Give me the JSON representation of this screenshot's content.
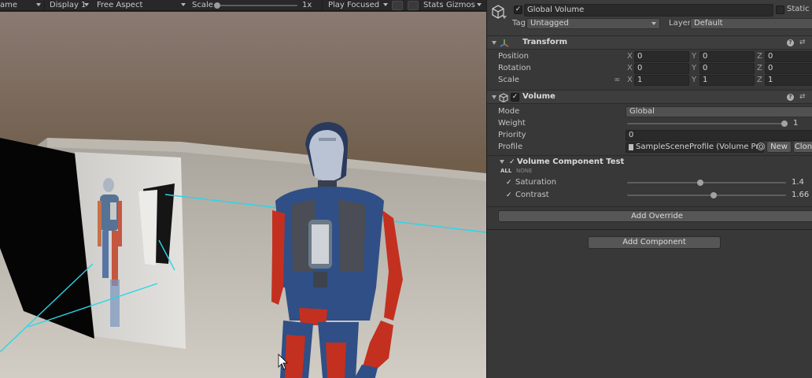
{
  "game_toolbar": {
    "tab_label": "ame",
    "display": "Display 1",
    "aspect": "Free Aspect",
    "scale_label": "Scale",
    "scale_value": "1x",
    "play_mode": "Play Focused",
    "stats": "Stats",
    "gizmos": "Gizmos"
  },
  "inspector": {
    "object_name": "Global Volume",
    "static_label": "Static",
    "tag_label": "Tag",
    "tag_value": "Untagged",
    "layer_label": "Layer",
    "layer_value": "Default",
    "transform": {
      "title": "Transform",
      "position_label": "Position",
      "rotation_label": "Rotation",
      "scale_label": "Scale",
      "axis_x": "X",
      "axis_y": "Y",
      "axis_z": "Z",
      "position": [
        "0",
        "0",
        "0"
      ],
      "rotation": [
        "0",
        "0",
        "0"
      ],
      "scale": [
        "1",
        "1",
        "1"
      ]
    },
    "volume": {
      "title": "Volume",
      "mode_label": "Mode",
      "mode_value": "Global",
      "weight_label": "Weight",
      "weight_value": "1",
      "weight_fraction": 1.0,
      "priority_label": "Priority",
      "priority_value": "0",
      "profile_label": "Profile",
      "profile_value": "SampleSceneProfile (Volume Profile",
      "new_button": "New",
      "clone_button": "Clone"
    },
    "volume_component": {
      "title": "Volume Component Test",
      "all_label": "ALL",
      "none_label": "NONE",
      "saturation_label": "Saturation",
      "saturation_value": "1.4",
      "contrast_label": "Contrast",
      "contrast_value": "1.66"
    },
    "add_override": "Add Override",
    "add_component": "Add Component"
  },
  "colors": {
    "inspector_bg": "#383838",
    "field_bg": "#2a2a2a",
    "button_bg": "#565656",
    "cyan_grid_line": "#29d6e8",
    "robot_blue": "#2f4f86",
    "robot_red": "#c4301f"
  }
}
